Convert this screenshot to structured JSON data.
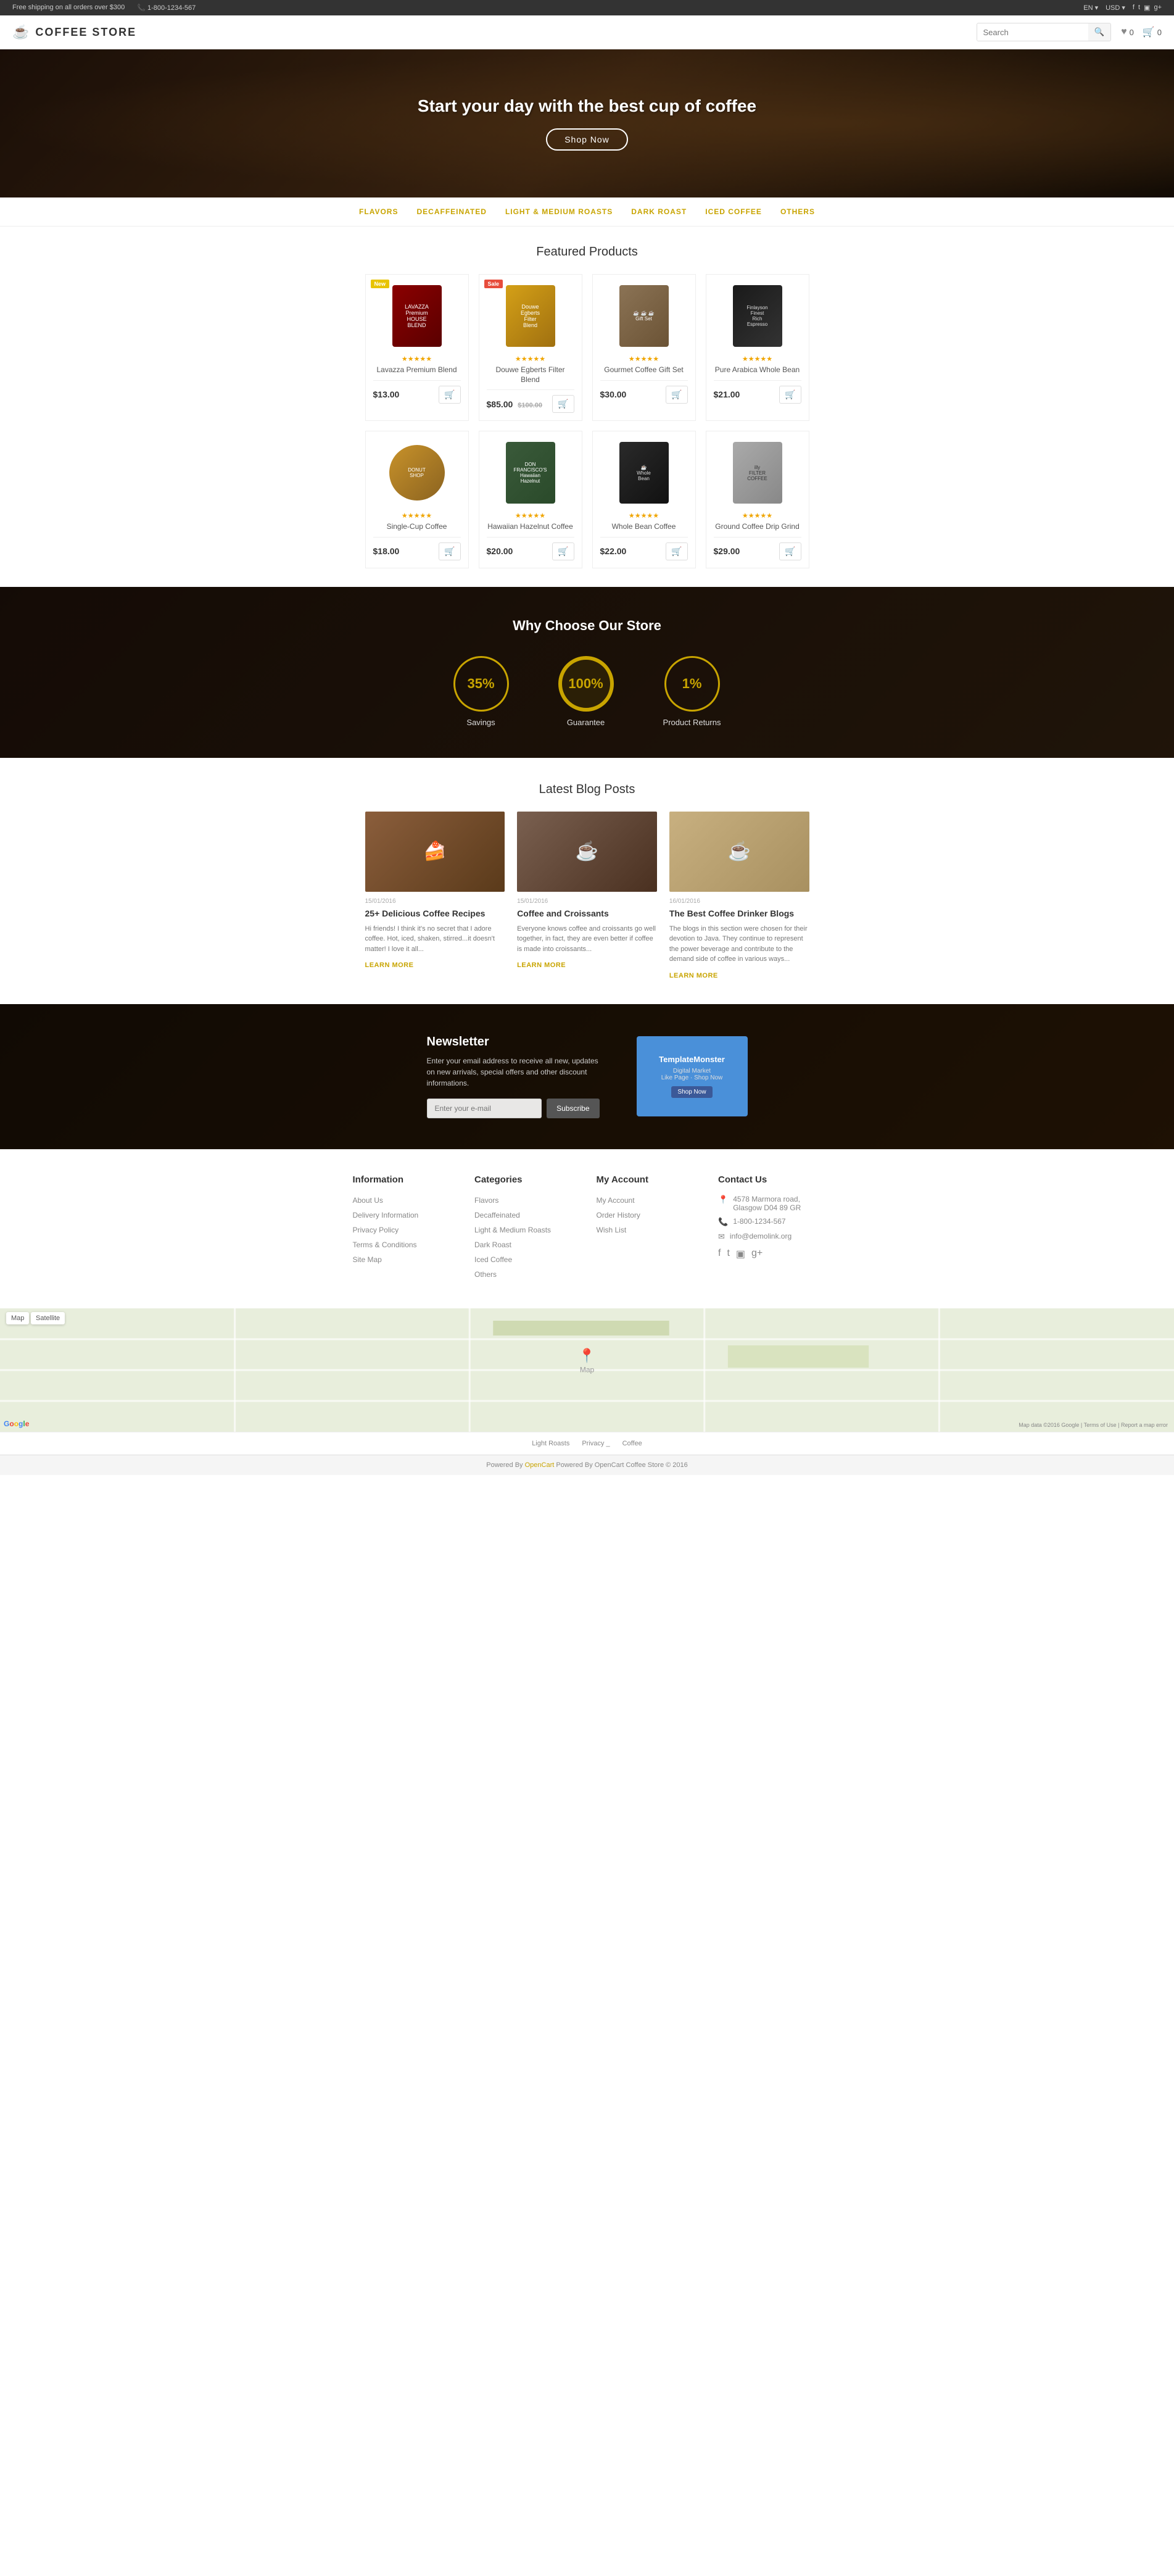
{
  "topbar": {
    "shipping": "Free shipping on all orders over $300",
    "phone": "1-800-1234-567",
    "lang": "EN",
    "currency": "USD",
    "social": [
      "f",
      "t",
      "ig",
      "g+"
    ]
  },
  "header": {
    "logo": "COFFEE STORE",
    "search_placeholder": "Search",
    "wishlist_count": "0",
    "cart_count": "0"
  },
  "hero": {
    "title": "Start your day with the best cup of coffee",
    "cta": "Shop Now"
  },
  "nav": {
    "items": [
      {
        "label": "FLAVORS"
      },
      {
        "label": "DECAFFEINATED"
      },
      {
        "label": "LIGHT & MEDIUM ROASTS"
      },
      {
        "label": "DARK ROAST"
      },
      {
        "label": "ICED COFFEE"
      },
      {
        "label": "OTHERS"
      }
    ]
  },
  "featured": {
    "title": "Featured Products",
    "products": [
      {
        "name": "Lavazza Premium Blend",
        "price": "$13.00",
        "old_price": "",
        "badge": "New",
        "badge_type": "new",
        "stars": "★★★★★",
        "style": "brown"
      },
      {
        "name": "Douwe Egberts Filter Blend",
        "price": "$85.00",
        "old_price": "$100.00",
        "badge": "Sale",
        "badge_type": "sale",
        "stars": "★★★★★",
        "style": "gold"
      },
      {
        "name": "Gourmet Coffee Gift Set",
        "price": "$30.00",
        "old_price": "",
        "badge": "",
        "badge_type": "",
        "stars": "★★★★★",
        "style": "gift"
      },
      {
        "name": "Pure Arabica Whole Bean",
        "price": "$21.00",
        "old_price": "",
        "badge": "",
        "badge_type": "",
        "stars": "★★★★★",
        "style": "black"
      },
      {
        "name": "Single-Cup Coffee",
        "price": "$18.00",
        "old_price": "",
        "badge": "",
        "badge_type": "",
        "stars": "★★★★★",
        "style": "donut"
      },
      {
        "name": "Hawaiian Hazelnut Coffee",
        "price": "$20.00",
        "old_price": "",
        "badge": "",
        "badge_type": "",
        "stars": "★★★★★",
        "style": "green-can"
      },
      {
        "name": "Whole Bean Coffee",
        "price": "$22.00",
        "old_price": "",
        "badge": "",
        "badge_type": "",
        "stars": "★★★★★",
        "style": "dark-can"
      },
      {
        "name": "Ground Coffee Drip Grind",
        "price": "$29.00",
        "old_price": "",
        "badge": "",
        "badge_type": "",
        "stars": "★★★★★",
        "style": "silver-can"
      }
    ]
  },
  "why": {
    "title": "Why Choose Our Store",
    "stats": [
      {
        "value": "35%",
        "label": "Savings"
      },
      {
        "value": "100%",
        "label": "Guarantee"
      },
      {
        "value": "1%",
        "label": "Product Returns"
      }
    ]
  },
  "blog": {
    "title": "Latest Blog Posts",
    "posts": [
      {
        "date": "15/01/2016",
        "title": "25+ Delicious Coffee Recipes",
        "text": "Hi friends! I think it's no secret that I adore coffee. Hot, iced, shaken, stirred...it doesn't matter! I love it all...",
        "link": "LEARN MORE",
        "style": "food"
      },
      {
        "date": "15/01/2016",
        "title": "Coffee and Croissants",
        "text": "Everyone knows coffee and croissants go well together, in fact, they are even better if coffee is made into croissants...",
        "link": "LEARN MORE",
        "style": "latte"
      },
      {
        "date": "16/01/2016",
        "title": "The Best Coffee Drinker Blogs",
        "text": "The blogs in this section were chosen for their devotion to Java. They continue to represent the power beverage and contribute to the demand side of coffee in various ways...",
        "link": "LEARN MORE",
        "style": "espresso"
      }
    ]
  },
  "newsletter": {
    "title": "Newsletter",
    "text": "Enter your email address to receive all new, updates on new arrivals, special offers and other discount informations.",
    "input_placeholder": "Enter your e-mail",
    "button_label": "Subscribe",
    "widget_label": "TemplateMonster"
  },
  "footer": {
    "information": {
      "title": "Information",
      "links": [
        "About Us",
        "Delivery Information",
        "Privacy Policy",
        "Terms & Conditions",
        "Site Map"
      ]
    },
    "categories": {
      "title": "Categories",
      "links": [
        "Flavors",
        "Decaffeinated",
        "Light & Medium Roasts",
        "Dark Roast",
        "Iced Coffee",
        "Others"
      ]
    },
    "account": {
      "title": "My Account",
      "links": [
        "My Account",
        "Order History",
        "Wish List"
      ]
    },
    "contact": {
      "title": "Contact Us",
      "address": "4578 Marmora road, Glasgow D04 89 GR",
      "phone": "1-800-1234-567",
      "email": "info@demolink.org"
    }
  },
  "footer_links": {
    "items": [
      {
        "label": "Light Roasts"
      },
      {
        "label": "Privacy _"
      },
      {
        "label": "Coffee"
      }
    ]
  },
  "bottom": {
    "text": "Powered By OpenCart Coffee Store © 2016"
  }
}
